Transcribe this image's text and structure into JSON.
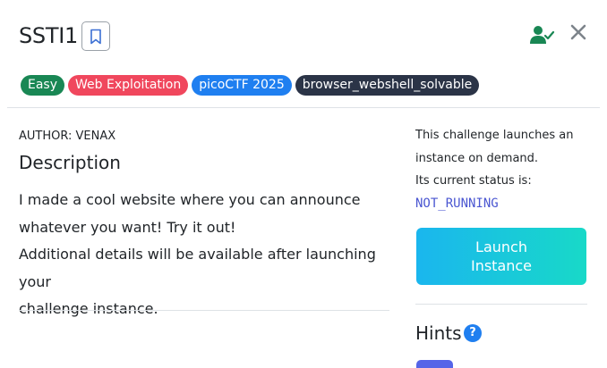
{
  "challenge": {
    "title": "SSTI1",
    "tags": [
      {
        "label": "Easy",
        "color": "#198754"
      },
      {
        "label": "Web Exploitation",
        "color": "#f0475d"
      },
      {
        "label": "picoCTF 2025",
        "color": "#1f7ff0"
      },
      {
        "label": "browser_webshell_solvable",
        "color": "#2b3447"
      }
    ],
    "author": "AUTHOR: VENAX",
    "description_heading": "Description",
    "description_lines": [
      "I made a cool website where you can announce",
      "whatever you want! Try it out!",
      "Additional details will be available after launching your",
      "challenge instance."
    ]
  },
  "instance": {
    "info_lines": [
      "This challenge launches an",
      "instance on demand.",
      "Its current status is:"
    ],
    "status": "NOT_RUNNING",
    "status_color": "#4a56d1",
    "launch_button_lines": [
      "Launch",
      "Instance"
    ]
  },
  "hints": {
    "heading": "Hints",
    "help_symbol": "?"
  },
  "icons": {
    "bookmark": "bookmark-icon",
    "solved_user": "user-check-icon",
    "close": "close-icon",
    "help": "question-circle-icon"
  }
}
